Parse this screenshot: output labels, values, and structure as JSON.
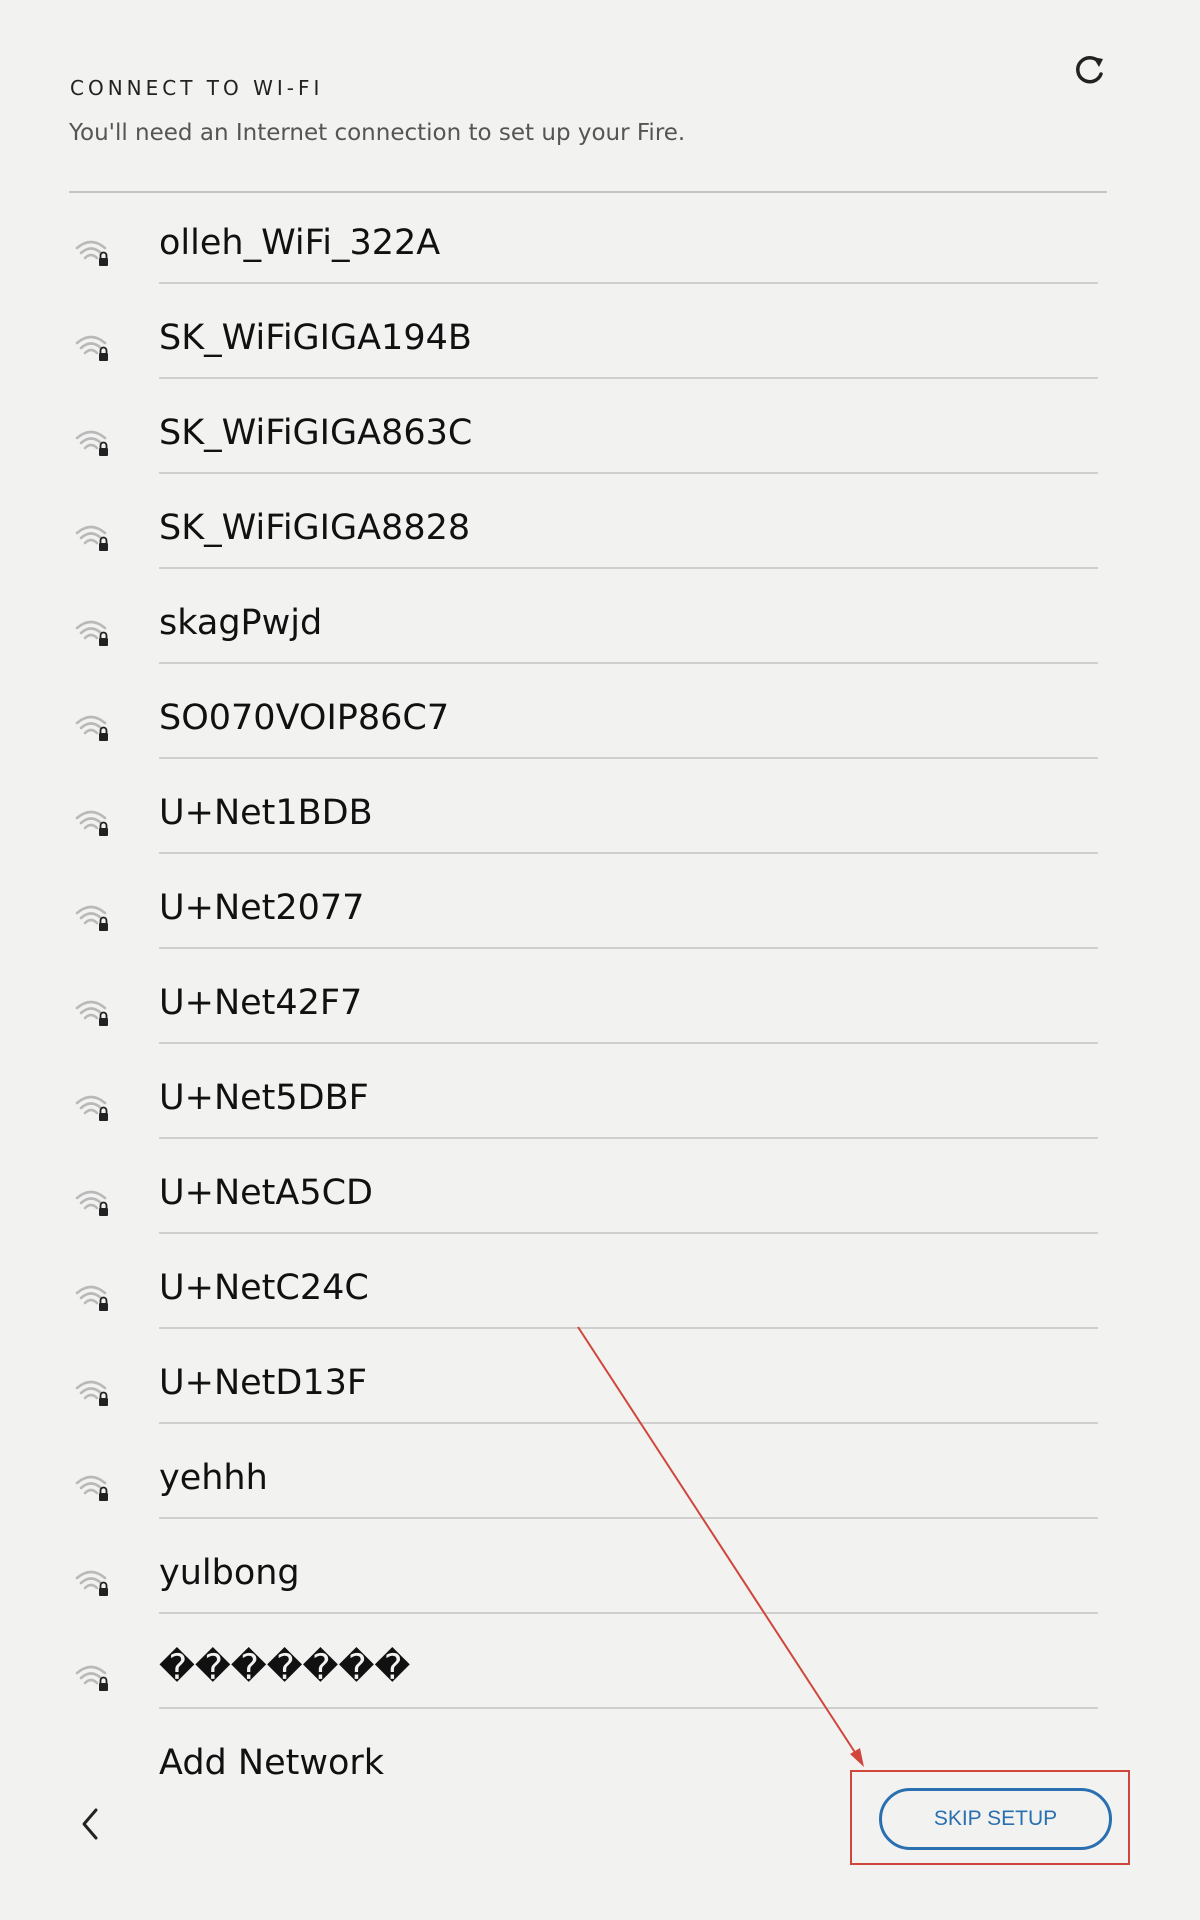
{
  "header": {
    "title": "CONNECT TO WI-FI",
    "subtitle": "You'll need an Internet connection to set up your Fire."
  },
  "icons": {
    "refresh": "refresh-icon",
    "network": "wifi-lock-icon",
    "back": "chevron-left-icon",
    "add": "plus-icon"
  },
  "networks": [
    {
      "name": "olleh_WiFi_322A"
    },
    {
      "name": "SK_WiFiGIGA194B"
    },
    {
      "name": "SK_WiFiGIGA863C"
    },
    {
      "name": "SK_WiFiGIGA8828"
    },
    {
      "name": "skagPwjd"
    },
    {
      "name": "SO070VOIP86C7"
    },
    {
      "name": "U+Net1BDB"
    },
    {
      "name": "U+Net2077"
    },
    {
      "name": "U+Net42F7"
    },
    {
      "name": "U+Net5DBF"
    },
    {
      "name": "U+NetA5CD"
    },
    {
      "name": "U+NetC24C"
    },
    {
      "name": "U+NetD13F"
    },
    {
      "name": "yehhh"
    },
    {
      "name": "yulbong"
    },
    {
      "name": "�������"
    }
  ],
  "add_network": {
    "label": "Add Network",
    "icon_glyph": "+"
  },
  "footer": {
    "skip_label": "SKIP SETUP"
  },
  "colors": {
    "background": "#f2f2f1",
    "accent": "#2a6fb0",
    "annotation": "#d0463c",
    "divider": "#cfcfcf"
  }
}
